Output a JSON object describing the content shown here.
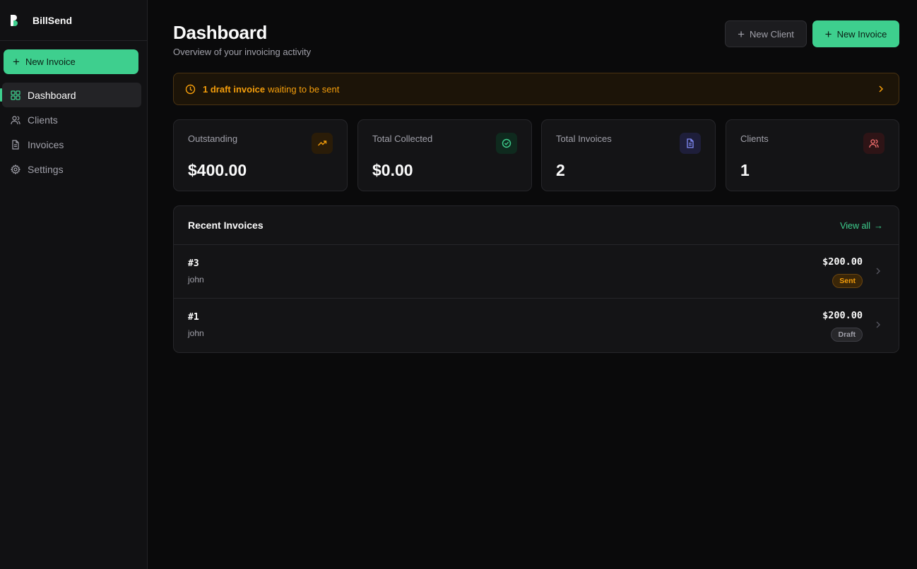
{
  "brand": {
    "name": "BillSend"
  },
  "sidebar": {
    "new_invoice_label": "New Invoice",
    "items": [
      {
        "label": "Dashboard",
        "icon": "grid-icon",
        "active": true
      },
      {
        "label": "Clients",
        "icon": "users-icon",
        "active": false
      },
      {
        "label": "Invoices",
        "icon": "file-icon",
        "active": false
      },
      {
        "label": "Settings",
        "icon": "gear-icon",
        "active": false
      }
    ]
  },
  "header": {
    "title": "Dashboard",
    "subtitle": "Overview of your invoicing activity",
    "new_client_label": "New Client",
    "new_invoice_label": "New Invoice"
  },
  "alert": {
    "highlight": "1 draft invoice",
    "text": "waiting to be sent"
  },
  "stats": [
    {
      "label": "Outstanding",
      "value": "$400.00",
      "icon": "trending-up-icon",
      "color": "#f59e0b"
    },
    {
      "label": "Total Collected",
      "value": "$0.00",
      "icon": "check-circle-icon",
      "color": "#3ecf8e"
    },
    {
      "label": "Total Invoices",
      "value": "2",
      "icon": "document-icon",
      "color": "#818cf8"
    },
    {
      "label": "Clients",
      "value": "1",
      "icon": "users-icon",
      "color": "#f87171"
    }
  ],
  "recent": {
    "title": "Recent Invoices",
    "view_all": "View all",
    "rows": [
      {
        "number": "#3",
        "client": "john",
        "amount": "$200.00",
        "status": "Sent"
      },
      {
        "number": "#1",
        "client": "john",
        "amount": "$200.00",
        "status": "Draft"
      }
    ]
  },
  "colors": {
    "accent": "#3ecf8e",
    "warning": "#f59e0b",
    "background": "#0a0a0b"
  }
}
